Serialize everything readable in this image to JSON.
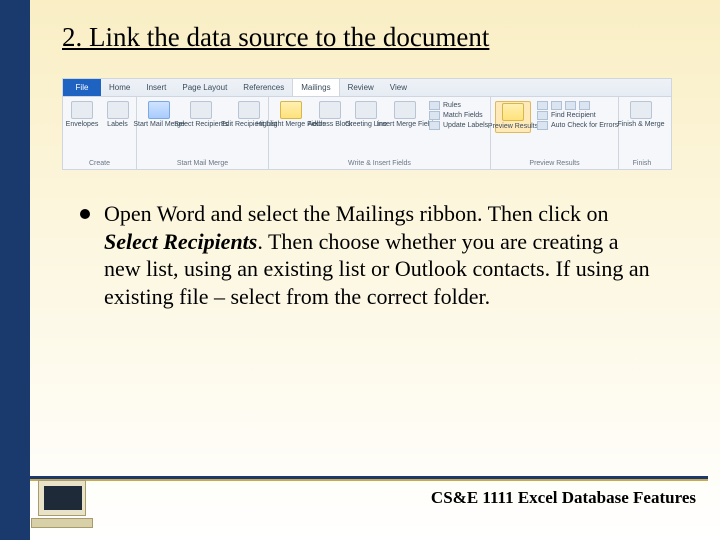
{
  "title": "2. Link the data source to the document",
  "ribbon": {
    "file": "File",
    "tabs": [
      "Home",
      "Insert",
      "Page Layout",
      "References",
      "Mailings",
      "Review",
      "View"
    ],
    "active_tab": 4,
    "groups": [
      {
        "buttons": [
          {
            "label": "Envelopes"
          },
          {
            "label": "Labels"
          }
        ],
        "name": "Create"
      },
      {
        "buttons": [
          {
            "label": "Start Mail\nMerge"
          },
          {
            "label": "Select\nRecipients"
          },
          {
            "label": "Edit\nRecipient List"
          }
        ],
        "name": "Start Mail Merge"
      },
      {
        "buttons": [
          {
            "label": "Highlight\nMerge Fields"
          },
          {
            "label": "Address\nBlock"
          },
          {
            "label": "Greeting\nLine"
          },
          {
            "label": "Insert Merge\nField"
          }
        ],
        "side": [
          {
            "label": "Rules"
          },
          {
            "label": "Match Fields"
          },
          {
            "label": "Update Labels"
          }
        ],
        "name": "Write & Insert Fields"
      },
      {
        "buttons": [
          {
            "label": "Preview\nResults"
          }
        ],
        "side": [
          {
            "label": "Find Recipient"
          },
          {
            "label": "Auto Check for Errors"
          }
        ],
        "name": "Preview Results",
        "highlight": true
      },
      {
        "buttons": [
          {
            "label": "Finish &\nMerge"
          }
        ],
        "name": "Finish"
      }
    ]
  },
  "body": {
    "text_pre": "Open Word and select the Mailings ribbon.  Then click on ",
    "select_recipients": "Select Recipients",
    "text_post": ". Then choose whether you are creating a new list, using an existing list or Outlook contacts. If using an existing file – select from the correct folder."
  },
  "footer": "CS&E 1111 Excel Database Features"
}
